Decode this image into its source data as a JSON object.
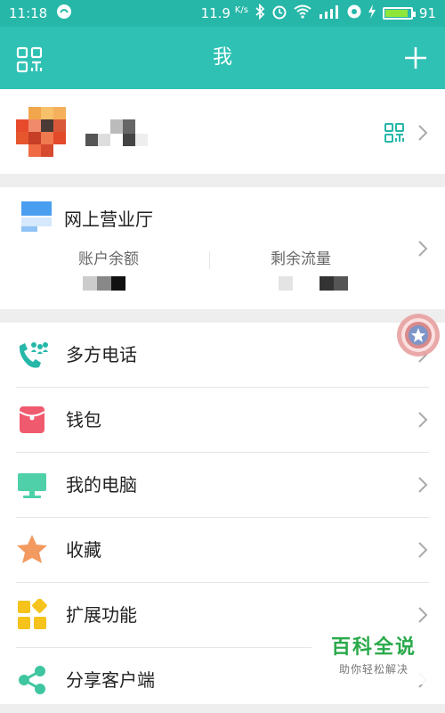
{
  "status_bar": {
    "time": "11:18",
    "net_speed": "11.9",
    "net_unit": "K/s",
    "battery": "91",
    "battery_level": 0.91
  },
  "header": {
    "title": "我"
  },
  "business_hall": {
    "title": "网上营业厅",
    "balance_label": "账户余额",
    "data_label": "剩余流量"
  },
  "menu": {
    "items": [
      {
        "label": "多方电话",
        "icon": "conference-call-icon"
      },
      {
        "label": "钱包",
        "icon": "wallet-icon"
      },
      {
        "label": "我的电脑",
        "icon": "computer-icon"
      },
      {
        "label": "收藏",
        "icon": "star-icon"
      },
      {
        "label": "扩展功能",
        "icon": "extensions-icon"
      },
      {
        "label": "分享客户端",
        "icon": "share-icon"
      }
    ]
  },
  "watermark": {
    "main": "百科全说",
    "sub": "助你轻松解决"
  },
  "colors": {
    "accent": "#2ec1b4",
    "status_bar": "#26b7a9"
  }
}
